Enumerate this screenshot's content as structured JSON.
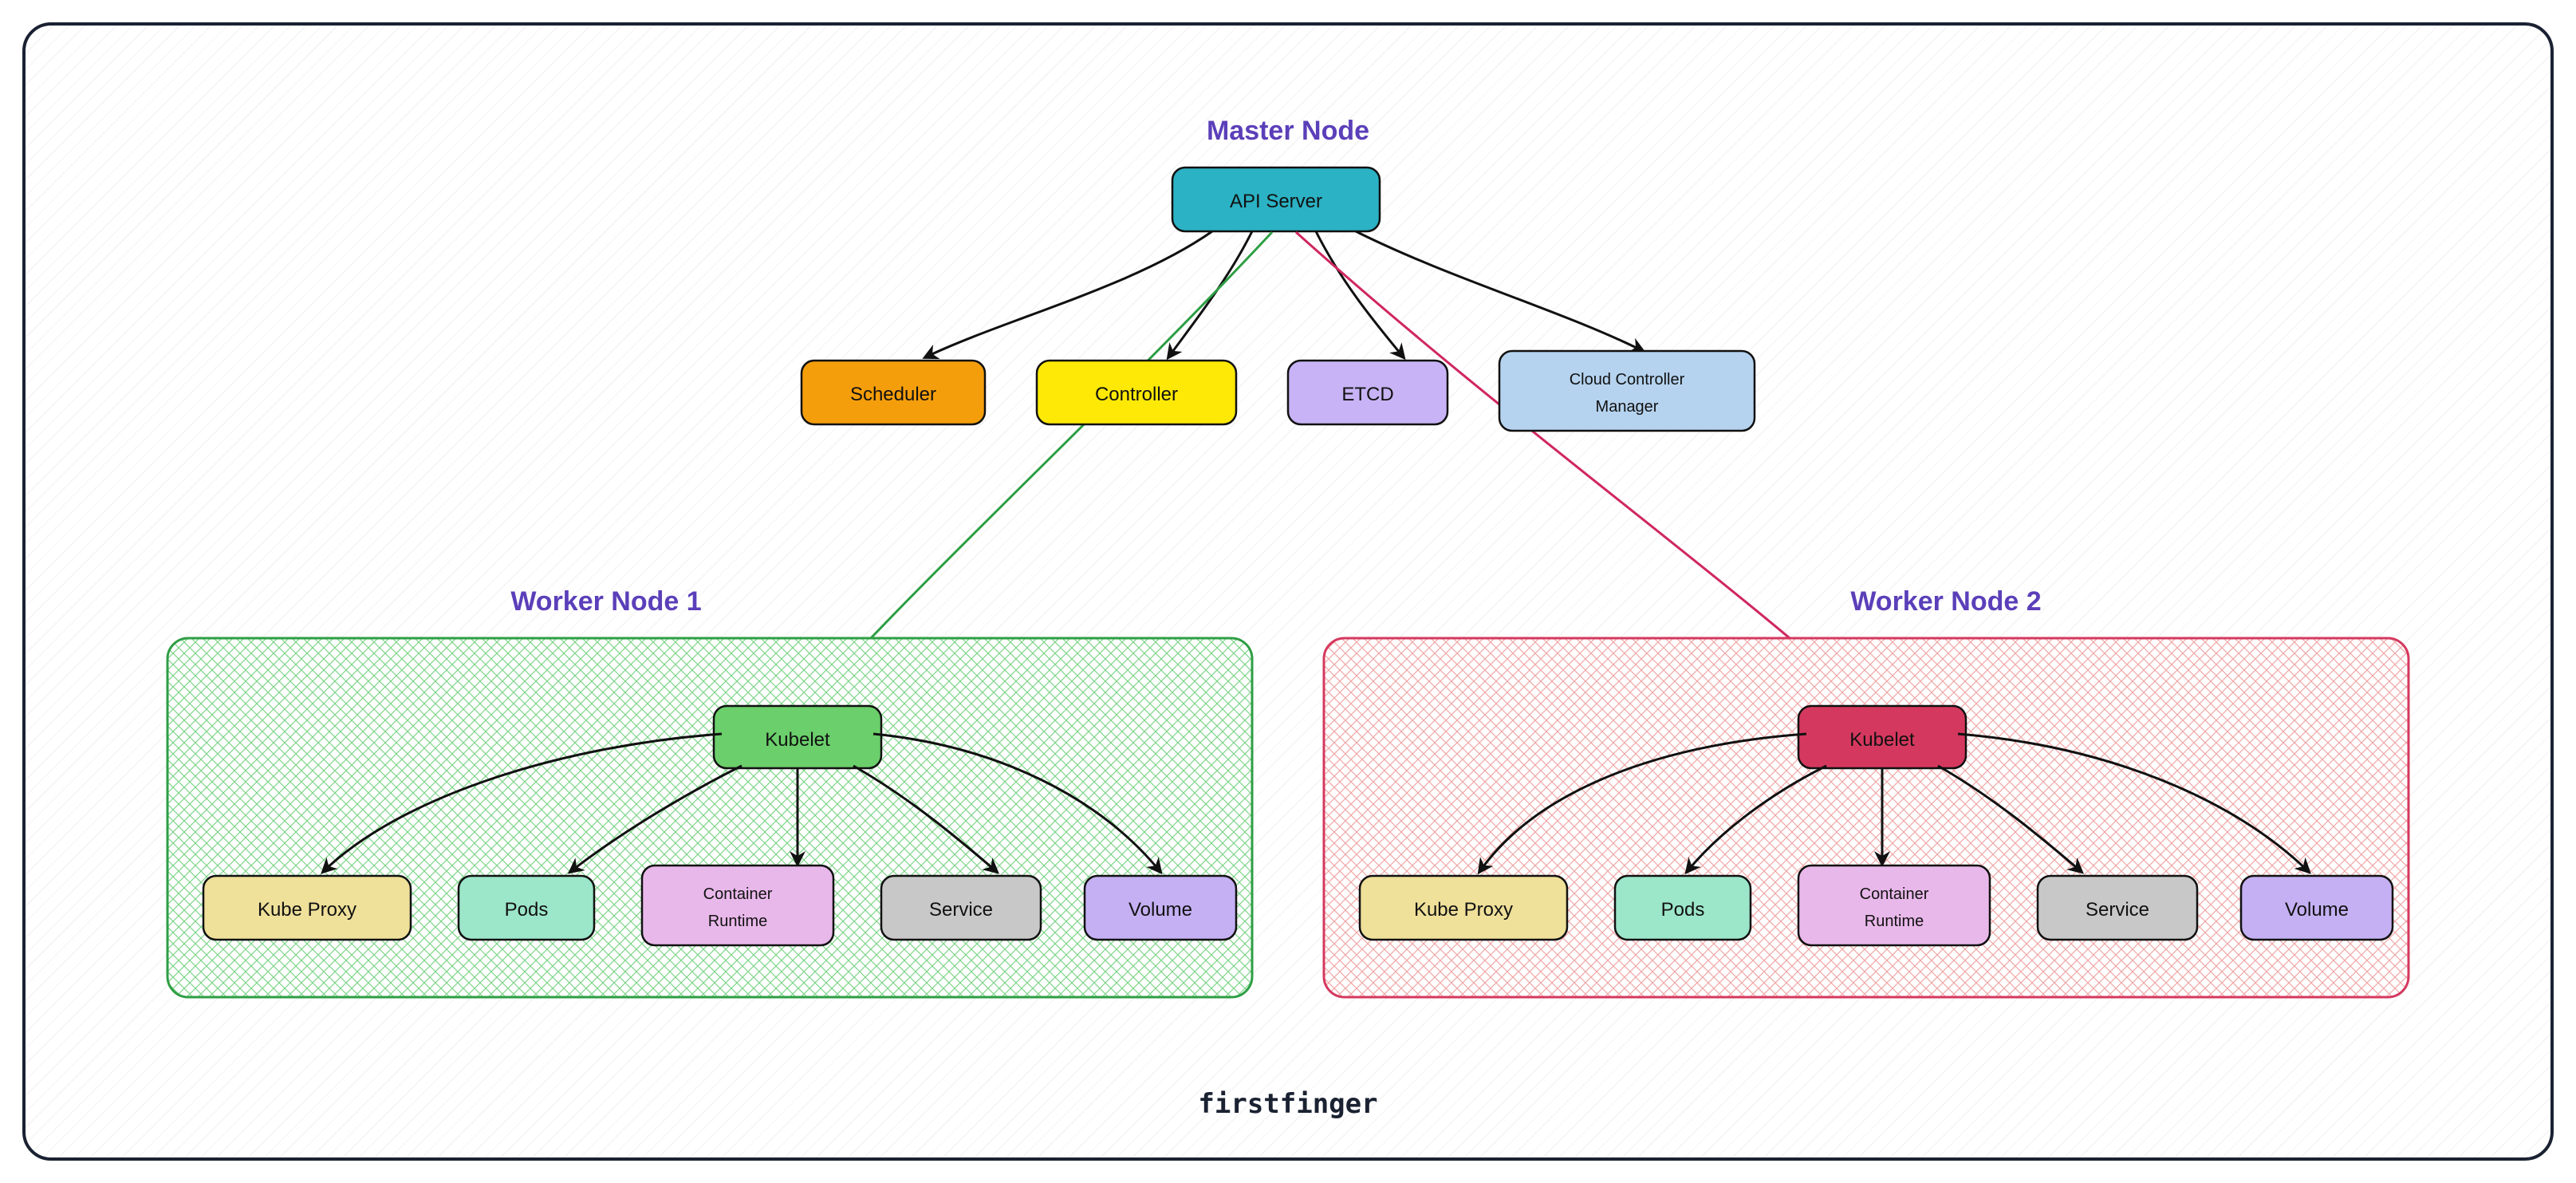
{
  "diagram": {
    "master_title": "Master Node",
    "master": {
      "api_server": "API Server",
      "scheduler": "Scheduler",
      "controller": "Controller",
      "etcd": "ETCD",
      "cloud_controller_manager_l1": "Cloud Controller",
      "cloud_controller_manager_l2": "Manager"
    },
    "worker1_title": "Worker Node 1",
    "worker2_title": "Worker Node 2",
    "worker": {
      "kubelet": "Kubelet",
      "kube_proxy": "Kube Proxy",
      "pods": "Pods",
      "container_runtime_l1": "Container",
      "container_runtime_l2": "Runtime",
      "service": "Service",
      "volume": "Volume"
    },
    "footer": "firstfinger",
    "colors": {
      "teal": "#2bb2c4",
      "orange": "#f59e0b",
      "yellow": "#fde905",
      "lilac": "#c8b3f6",
      "lightblue": "#b5d3ef",
      "khaki": "#efe09a",
      "mint": "#9ce6c9",
      "pink": "#e9b8ea",
      "gray": "#c8c8c8",
      "lavender": "#c4b0f3",
      "green": "#6bcf6b",
      "crimson": "#d5385e",
      "purple_text": "#5b3fb9"
    }
  }
}
